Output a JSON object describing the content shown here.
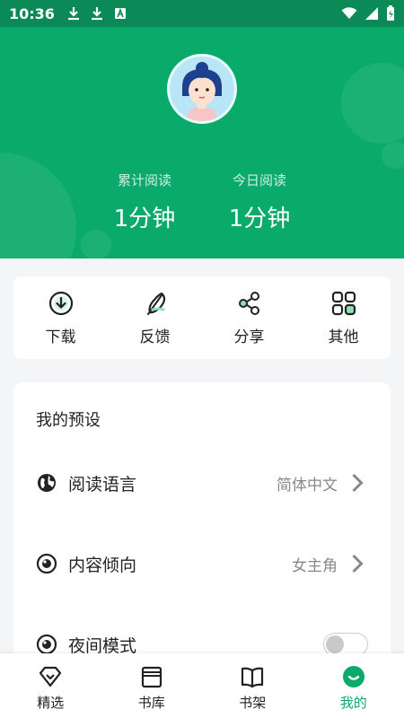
{
  "status_bar": {
    "time": "10:36",
    "left_icons": [
      "download-icon",
      "download-icon",
      "text-notification-icon"
    ],
    "right_icons": [
      "wifi-icon",
      "cell-signal-icon",
      "battery-charging-icon"
    ]
  },
  "header": {
    "avatar_icon": "user-avatar",
    "stats": [
      {
        "label": "累计阅读",
        "value": "1分钟"
      },
      {
        "label": "今日阅读",
        "value": "1分钟"
      }
    ]
  },
  "quick_actions": [
    {
      "label": "下载",
      "icon": "download-circle-icon"
    },
    {
      "label": "反馈",
      "icon": "feather-icon"
    },
    {
      "label": "分享",
      "icon": "share-icon"
    },
    {
      "label": "其他",
      "icon": "more-grid-icon"
    }
  ],
  "preferences": {
    "title": "我的预设",
    "rows": [
      {
        "label": "阅读语言",
        "value": "简体中文",
        "icon": "globe-icon"
      },
      {
        "label": "内容倾向",
        "value": "女主角",
        "icon": "eye-icon"
      },
      {
        "label": "夜间模式",
        "icon": "eye-icon",
        "toggle_on": false
      }
    ]
  },
  "bottom_nav": [
    {
      "label": "精选",
      "icon": "diamond-icon",
      "active": false
    },
    {
      "label": "书库",
      "icon": "library-icon",
      "active": false
    },
    {
      "label": "书架",
      "icon": "open-book-icon",
      "active": false
    },
    {
      "label": "我的",
      "icon": "smile-icon",
      "active": true
    }
  ],
  "colors": {
    "primary": "#0aaa6a",
    "status_bar": "#0b8a58",
    "background": "#f4f5f7"
  }
}
